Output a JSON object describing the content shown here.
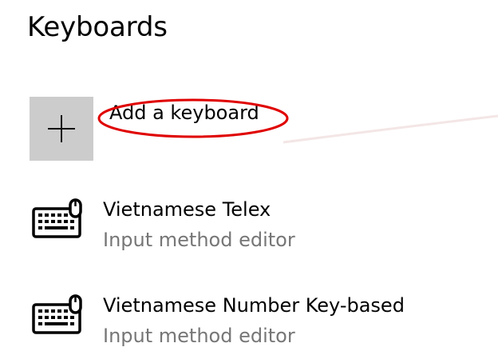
{
  "page": {
    "title": "Keyboards"
  },
  "add_keyboard": {
    "label": "Add a keyboard",
    "icon": "plus-icon",
    "tile_color": "#cccccc",
    "highlight_color": "#e00000"
  },
  "keyboards": [
    {
      "name": "Vietnamese Telex",
      "type": "Input method editor",
      "icon": "keyboard-icon"
    },
    {
      "name": "Vietnamese Number Key-based",
      "type": "Input method editor",
      "icon": "keyboard-icon"
    }
  ]
}
